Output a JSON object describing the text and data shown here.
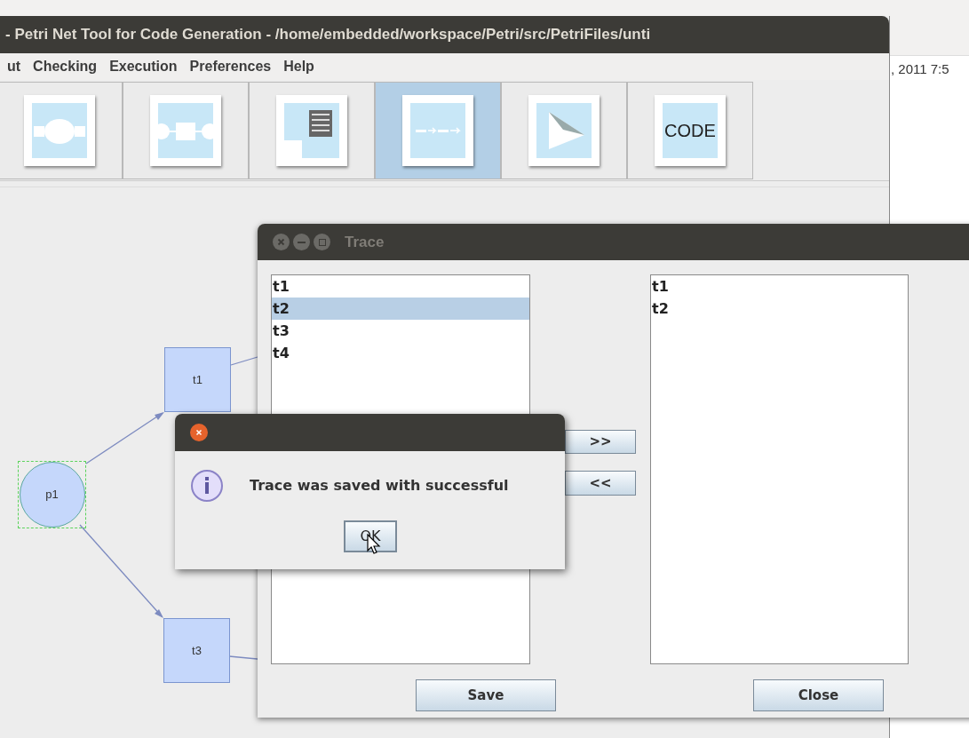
{
  "background_window": {
    "text": ", 2011 7:5"
  },
  "main_window": {
    "title": "- Petri Net Tool for Code Generation - /home/embedded/workspace/Petri/src/PetriFiles/unti",
    "menu": [
      {
        "label": "ut"
      },
      {
        "label": "Checking"
      },
      {
        "label": "Execution"
      },
      {
        "label": "Preferences"
      },
      {
        "label": "Help"
      }
    ],
    "toolbar": [
      {
        "kind": "place",
        "selected": false
      },
      {
        "kind": "transition",
        "selected": false
      },
      {
        "kind": "document",
        "selected": false
      },
      {
        "kind": "trace",
        "selected": true
      },
      {
        "kind": "play",
        "selected": false
      },
      {
        "kind": "code",
        "label": "CODE",
        "selected": false
      }
    ]
  },
  "net": {
    "places": [
      {
        "label": "p1",
        "selected": true
      }
    ],
    "transitions": [
      {
        "label": "t1"
      },
      {
        "label": "t3"
      }
    ]
  },
  "trace_dialog": {
    "title": "Trace",
    "available": [
      {
        "label": "t1",
        "selected": false
      },
      {
        "label": "t2",
        "selected": true
      },
      {
        "label": "t3",
        "selected": false
      },
      {
        "label": "t4",
        "selected": false
      }
    ],
    "add_button": ">>",
    "remove_button": "<<",
    "trace": [
      {
        "label": "t1"
      },
      {
        "label": "t2"
      }
    ],
    "save_button": "Save",
    "close_button": "Close"
  },
  "message": {
    "text": "Trace was saved with successful",
    "ok_button": "OK"
  }
}
